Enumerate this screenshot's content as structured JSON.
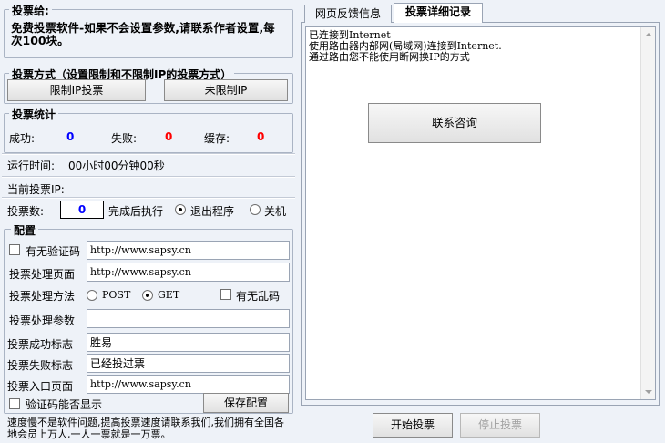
{
  "intro": {
    "title": "投票给:",
    "text": "免费投票软件-如果不会设置参数,请联系作者设置,每次100块。"
  },
  "mode": {
    "title": "投票方式（设置限制和不限制IP的投票方式）",
    "limited_label": "限制IP投票",
    "unlimited_label": "未限制IP"
  },
  "stats": {
    "title": "投票统计",
    "success_label": "成功:",
    "success_value": "0",
    "fail_label": "失败:",
    "fail_value": "0",
    "cache_label": "缓存:",
    "cache_value": "0",
    "runtime_label": "运行时间:",
    "runtime_value": "00小时00分钟00秒",
    "current_ip_label": "当前投票IP:",
    "count_label": "投票数:",
    "count_value": "0",
    "after_done_label": "完成后执行",
    "exit_label": "退出程序",
    "shutdown_label": "关机"
  },
  "config": {
    "title": "配置",
    "captcha_label": "有无验证码",
    "captcha_url": "http://www.sapsy.cn",
    "process_page_label": "投票处理页面",
    "process_page_url": "http://www.sapsy.cn",
    "method_label": "投票处理方法",
    "post_label": "POST",
    "get_label": "GET",
    "garble_label": "有无乱码",
    "params_label": "投票处理参数",
    "params_value": "",
    "success_flag_label": "投票成功标志",
    "success_flag_value": "胜易",
    "fail_flag_label": "投票失败标志",
    "fail_flag_value": "已经投过票",
    "entry_page_label": "投票入口页面",
    "entry_page_url": "http://www.sapsy.cn",
    "captcha_show_label": "验证码能否显示",
    "save_label": "保存配置"
  },
  "footer_note": "速度慢不是软件问题,提高投票速度请联系我们,我们拥有全国各地会员上万人,一人一票就是一万票。",
  "tabs": {
    "feedback": "网页反馈信息",
    "detail": "投票详细记录"
  },
  "log": {
    "line1": "已连接到Internet",
    "line2": "使用路由器内部网(局域网)连接到Internet.",
    "line3": "通过路由您不能使用断网换IP的方式"
  },
  "contact_label": "联系咨询",
  "start_label": "开始投票",
  "stop_label": "停止投票",
  "colors": {
    "background": "#eef2f8",
    "counter_blue": "#0000ff",
    "counter_red": "#ff0000"
  }
}
